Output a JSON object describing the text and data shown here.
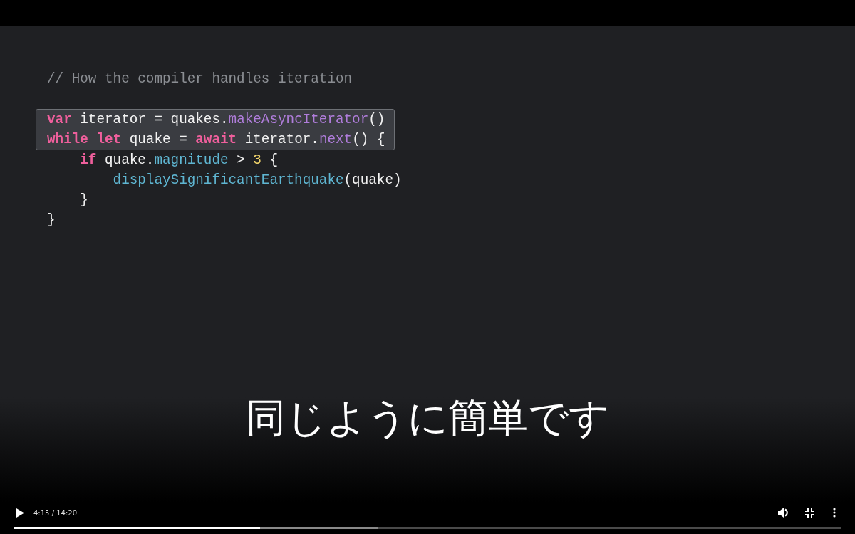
{
  "slide": {
    "comment": "// How the compiler handles iteration",
    "code_lines": [
      {
        "highlighted": true,
        "tokens": [
          {
            "kind": "keyword",
            "text": "var"
          },
          {
            "kind": "plain",
            "text": " iterator = quakes."
          },
          {
            "kind": "method",
            "text": "makeAsyncIterator"
          },
          {
            "kind": "plain",
            "text": "()"
          }
        ]
      },
      {
        "highlighted": true,
        "tokens": [
          {
            "kind": "keyword",
            "text": "while"
          },
          {
            "kind": "keyword",
            "text": " let"
          },
          {
            "kind": "plain",
            "text": " quake = "
          },
          {
            "kind": "keyword",
            "text": "await"
          },
          {
            "kind": "plain",
            "text": " iterator."
          },
          {
            "kind": "method",
            "text": "next"
          },
          {
            "kind": "plain",
            "text": "() {"
          }
        ]
      },
      {
        "highlighted": false,
        "tokens": [
          {
            "kind": "keyword",
            "text": "    if"
          },
          {
            "kind": "plain",
            "text": " quake."
          },
          {
            "kind": "property",
            "text": "magnitude"
          },
          {
            "kind": "plain",
            "text": " > "
          },
          {
            "kind": "number",
            "text": "3"
          },
          {
            "kind": "plain",
            "text": " {"
          }
        ]
      },
      {
        "highlighted": false,
        "tokens": [
          {
            "kind": "property",
            "text": "        displaySignificantEarthquake"
          },
          {
            "kind": "plain",
            "text": "(quake)"
          }
        ]
      },
      {
        "highlighted": false,
        "tokens": [
          {
            "kind": "plain",
            "text": "    }"
          }
        ]
      },
      {
        "highlighted": false,
        "tokens": [
          {
            "kind": "plain",
            "text": "}"
          }
        ]
      }
    ],
    "subtitle": "同じように簡単です"
  },
  "player": {
    "paused": true,
    "time": "4:15 / 14:20",
    "progress": {
      "level": 0.298,
      "buffer": {
        "level": 0.44
      }
    }
  }
}
